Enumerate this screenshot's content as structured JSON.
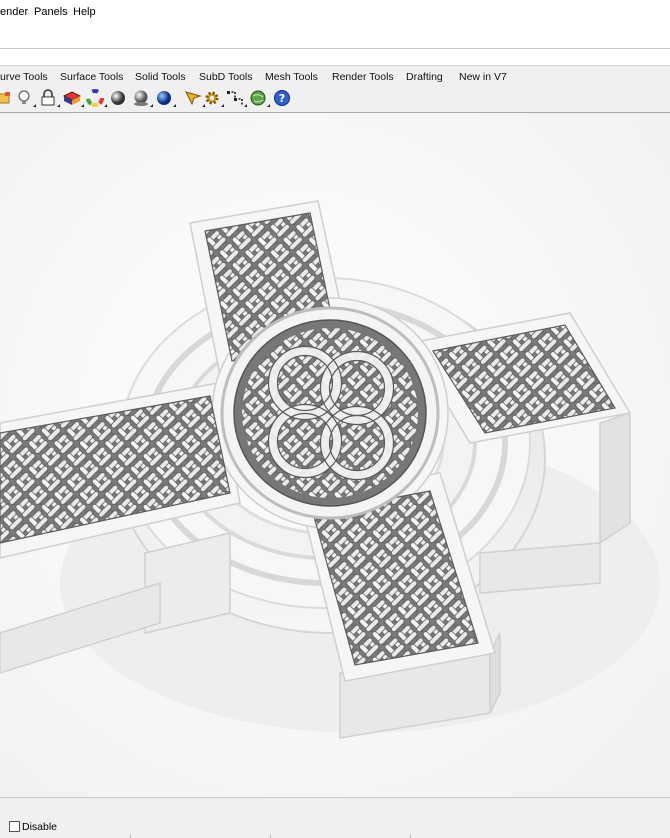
{
  "menubar": {
    "items": [
      "ender",
      "Panels",
      "Help"
    ]
  },
  "tabs": [
    "urve Tools",
    "Surface Tools",
    "Solid Tools",
    "SubD Tools",
    "Mesh Tools",
    "Render Tools",
    "Drafting",
    "New in V7"
  ],
  "toolbar": {
    "icons": [
      "folder-icon",
      "light-bulb-icon",
      "lock-icon",
      "material-icon",
      "color-wheel-icon",
      "render-sphere-icon",
      "environment-sphere-icon",
      "blue-sphere-icon",
      "pointer-icon",
      "gear-icon",
      "grid-snap-icon",
      "globe-icon",
      "help-icon"
    ]
  },
  "statusbar": {
    "disable_label": "Disable"
  },
  "colors": {
    "chrome": "#f0f0f0",
    "viewport": "#ffffff",
    "cross_face": "#f2f2f2",
    "knot_shadow": "#6f6f6f"
  }
}
